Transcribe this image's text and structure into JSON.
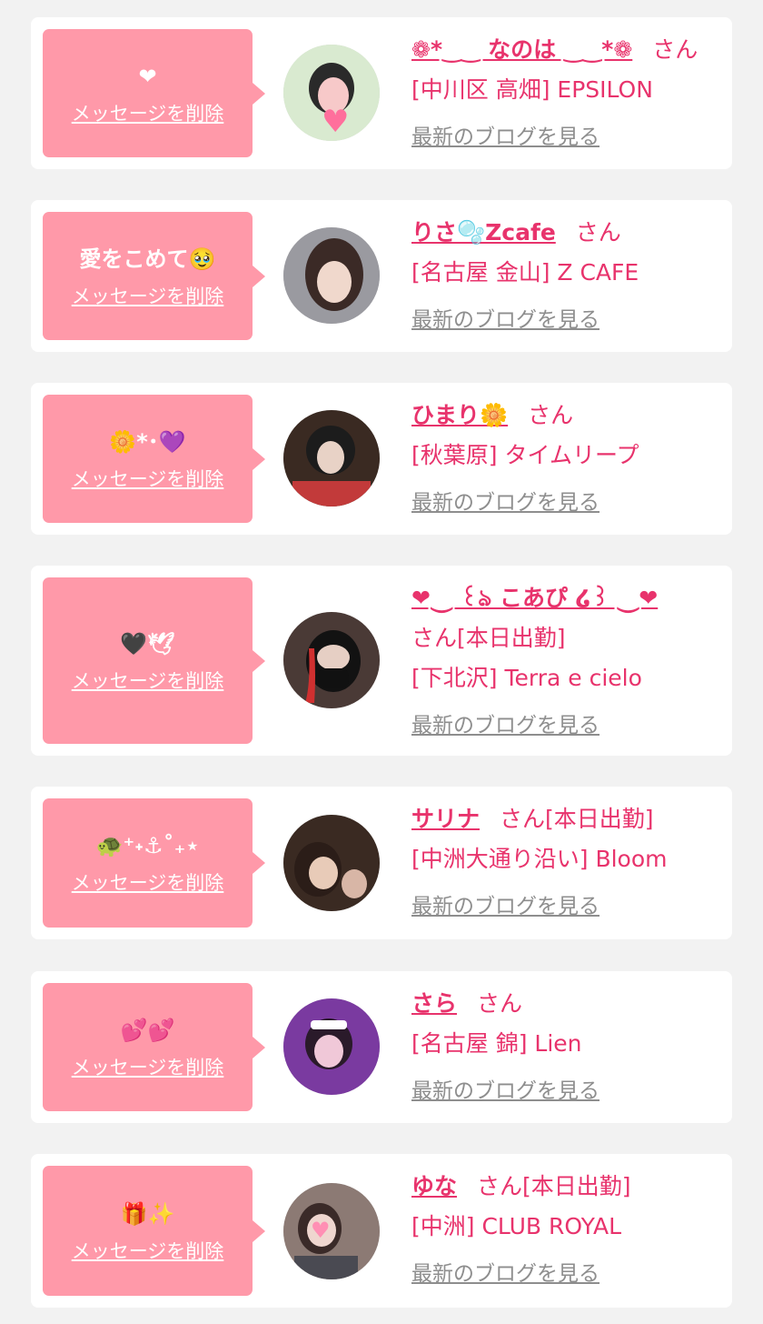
{
  "messages": [
    {
      "msg": "❤",
      "delete_label": "メッセージを削除",
      "name": "❁*‿‿ なのは ‿‿*❁",
      "san": "さん",
      "badge": "",
      "shop": "[中川区 高畑] EPSILON",
      "blog_label": "最新のブログを見る",
      "avatar_colors": [
        "#d9ead0",
        "#2a2a2a",
        "#f7c9c9"
      ]
    },
    {
      "msg": "愛をこめて🥹",
      "delete_label": "メッセージを削除",
      "name": "りさ🫧Zcafe",
      "san": "さん",
      "badge": "",
      "shop": "[名古屋 金山] Z CAFE",
      "blog_label": "最新のブログを見る",
      "avatar_colors": [
        "#9a9aa0",
        "#3b2a26",
        "#f0d8cc"
      ]
    },
    {
      "msg": "🌼*･💜",
      "delete_label": "メッセージを削除",
      "name": "ひまり🌼",
      "san": "さん",
      "badge": "",
      "shop": "[秋葉原] タイムリープ",
      "blog_label": "最新のブログを見る",
      "avatar_colors": [
        "#3a2a22",
        "#1c1c1c",
        "#c23a3a"
      ]
    },
    {
      "msg": "🖤🕊",
      "delete_label": "メッセージを削除",
      "name": "❤︎⏝ ꒰ঌ こあぴ ໒꒱ ⏝❤︎",
      "san": "さん",
      "badge": "[本日出勤]",
      "shop": "[下北沢] Terra e cielo",
      "blog_label": "最新のブログを見る",
      "avatar_colors": [
        "#4a3a36",
        "#121212",
        "#d03030"
      ]
    },
    {
      "msg": "🐢⁺˖⚓︎˚₊⋆",
      "delete_label": "メッセージを削除",
      "name": "サリナ",
      "san": "さん",
      "badge": "[本日出勤]",
      "shop": "[中洲大通り沿い] Bloom",
      "blog_label": "最新のブログを見る",
      "avatar_colors": [
        "#3a2a22",
        "#2b1d18",
        "#e8cbb8"
      ]
    },
    {
      "msg": "💕💕",
      "delete_label": "メッセージを削除",
      "name": "さら",
      "san": "さん",
      "badge": "",
      "shop": "[名古屋 錦] Lien",
      "blog_label": "最新のブログを見る",
      "avatar_colors": [
        "#7a3aa0",
        "#2a1a2a",
        "#f0c8d8"
      ]
    },
    {
      "msg": "🎁✨",
      "delete_label": "メッセージを削除",
      "name": "ゆな",
      "san": "さん",
      "badge": "[本日出勤]",
      "shop": "[中洲] CLUB ROYAL",
      "blog_label": "最新のブログを見る",
      "avatar_colors": [
        "#8c7a74",
        "#3a2a28",
        "#efd6cf"
      ]
    }
  ]
}
